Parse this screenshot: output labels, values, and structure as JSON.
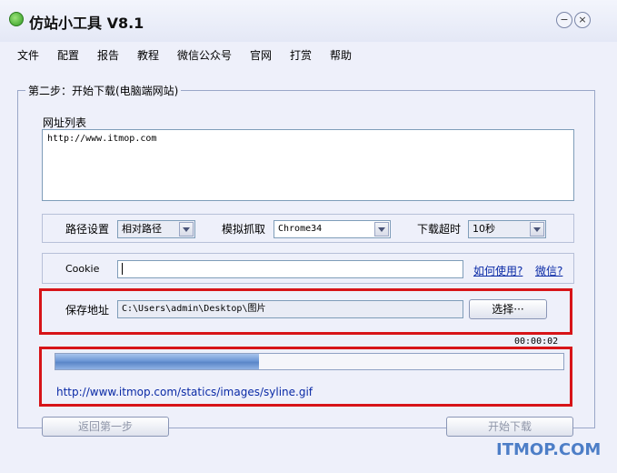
{
  "window": {
    "title": "仿站小工具 V8.1",
    "minimize_glyph": "−",
    "close_glyph": "×"
  },
  "menu": [
    "文件",
    "配置",
    "报告",
    "教程",
    "微信公众号",
    "官网",
    "打赏",
    "帮助"
  ],
  "step_group_title": "第二步：开始下载(电脑端网站)",
  "url_list": {
    "label": "网址列表",
    "value": "http://www.itmop.com"
  },
  "options": {
    "path_label": "路径设置",
    "path_value": "相对路径",
    "capture_label": "模拟抓取",
    "capture_value": "Chrome34",
    "timeout_label": "下载超时",
    "timeout_value": "10秒"
  },
  "cookie": {
    "label": "Cookie",
    "value": "",
    "how_link": "如何使用?",
    "wechat_link": "微信?"
  },
  "save": {
    "label": "保存地址",
    "value": "C:\\Users\\admin\\Desktop\\图片",
    "choose_label": "选择···"
  },
  "progress": {
    "elapsed": "00:00:02",
    "percent": 40,
    "current_url": "http://www.itmop.com/statics/images/syline.gif"
  },
  "buttons": {
    "back_label": "返回第一步",
    "start_label": "开始下载"
  },
  "watermark": "ITMOP.COM",
  "colors": {
    "accent_red": "#d71418",
    "link": "#0a2aa6",
    "progress": "#6e98d6"
  }
}
